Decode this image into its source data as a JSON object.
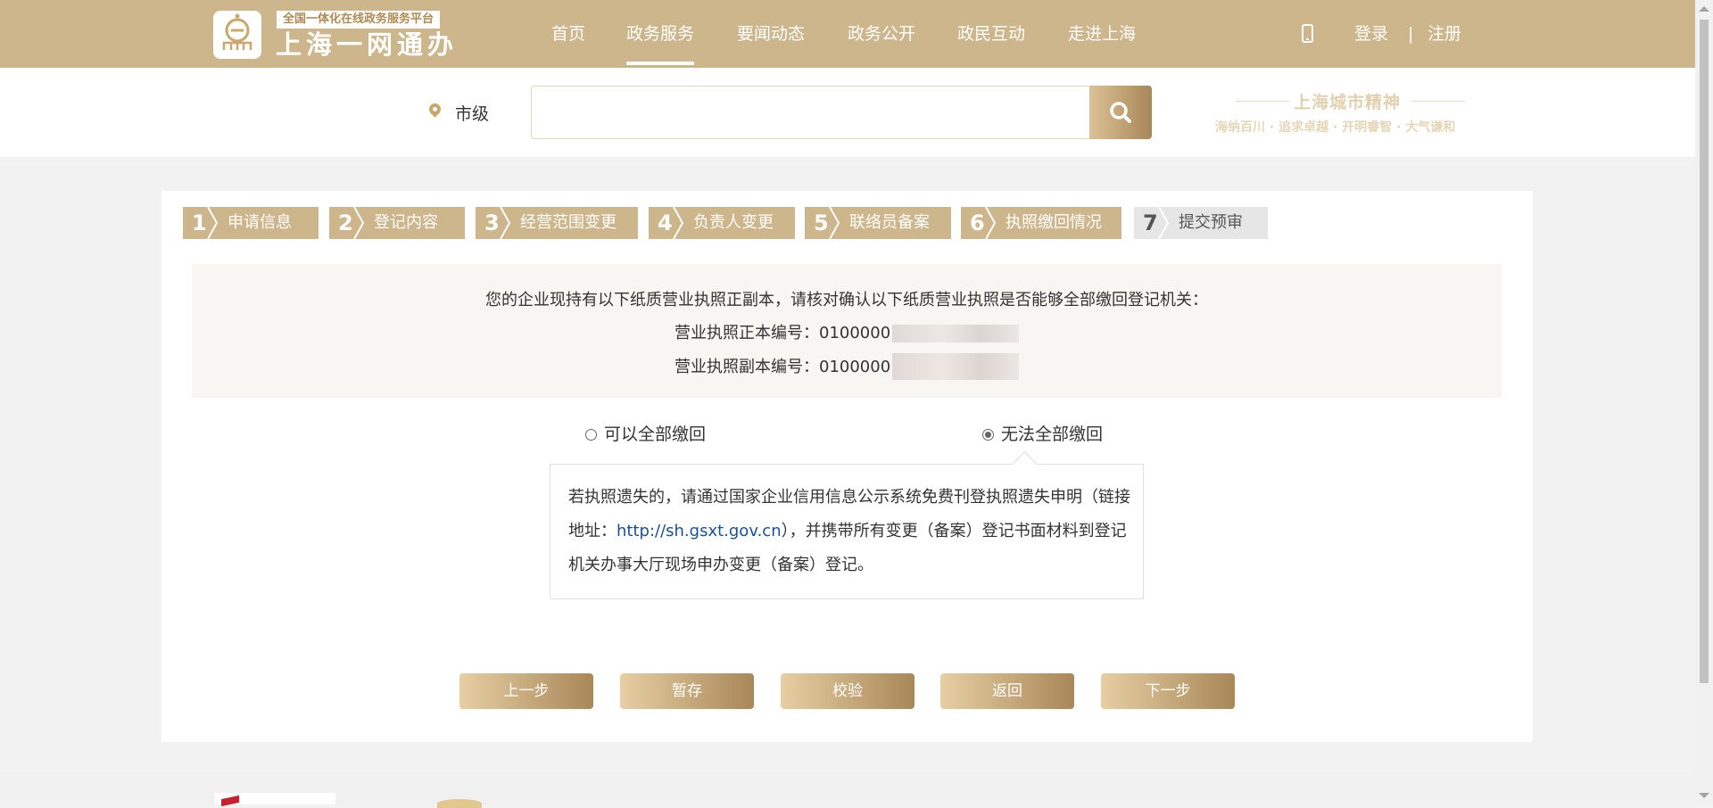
{
  "header": {
    "logo_tag": "全国一体化在线政务服务平台",
    "logo_name": "上海一网通办",
    "nav": [
      "首页",
      "政务服务",
      "要闻动态",
      "政务公开",
      "政民互动",
      "走进上海"
    ],
    "active_nav": "政务服务",
    "login": "登录",
    "separator": "|",
    "register": "注册"
  },
  "search": {
    "city": "市级",
    "placeholder": "",
    "spirit_title": "上海城市精神",
    "spirit_sub": "海纳百川 · 追求卓越 · 开明睿智 · 大气谦和"
  },
  "steps": [
    {
      "num": "1",
      "label": "申请信息",
      "state": "done"
    },
    {
      "num": "2",
      "label": "登记内容",
      "state": "done"
    },
    {
      "num": "3",
      "label": "经营范围变更",
      "state": "done"
    },
    {
      "num": "4",
      "label": "负责人变更",
      "state": "done"
    },
    {
      "num": "5",
      "label": "联络员备案",
      "state": "done"
    },
    {
      "num": "6",
      "label": "执照缴回情况",
      "state": "current"
    },
    {
      "num": "7",
      "label": "提交预审",
      "state": "pending"
    }
  ],
  "notice": {
    "intro": "您的企业现持有以下纸质营业执照正副本，请核对确认以下纸质营业执照是否能够全部缴回登记机关：",
    "original_label": "营业执照正本编号：",
    "original_value": "0100000",
    "copy_label": "营业执照副本编号：",
    "copy_value": "0100000"
  },
  "options": {
    "can_return": "可以全部缴回",
    "cannot_return": "无法全部缴回",
    "selected": "cannot_return"
  },
  "tip": {
    "part1": "若执照遗失的，请通过国家企业信用信息公示系统免费刊登执照遗失申明（链接地址：",
    "link": "http://sh.gsxt.gov.cn",
    "part2": "），并携带所有变更（备案）登记书面材料到登记机关办事大厅现场申办变更（备案）登记。"
  },
  "buttons": {
    "prev": "上一步",
    "save": "暂存",
    "validate": "校验",
    "back": "返回",
    "next": "下一步"
  },
  "colors": {
    "brand": "#cdb68b",
    "step_done": "#cdb68b",
    "step_pending": "#e6e6e6",
    "link": "#1a4f9c"
  }
}
